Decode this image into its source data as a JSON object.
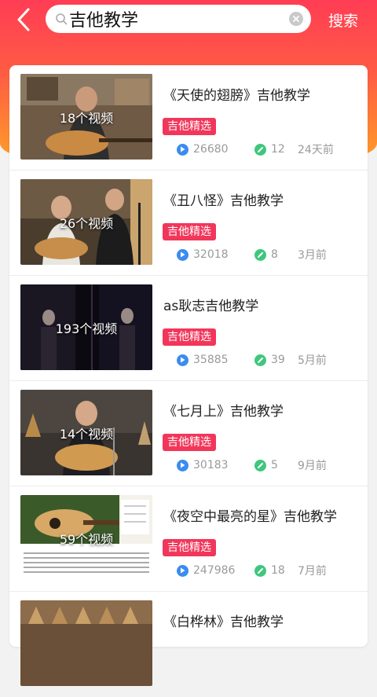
{
  "search": {
    "query": "吉他教学",
    "button_label": "搜索"
  },
  "colors": {
    "accent": "#f2365a",
    "header_top": "#ff3d55",
    "header_bottom": "#ff9a2a",
    "play": "#3b8cf0",
    "notes": "#3fc77d"
  },
  "items": [
    {
      "title": "《天使的翅膀》吉他教学",
      "count_label": "18个视频",
      "tag": "吉他精选",
      "views": "26680",
      "notes": "12",
      "age": "24天前"
    },
    {
      "title": "《丑八怪》吉他教学",
      "count_label": "26个视频",
      "tag": "吉他精选",
      "views": "32018",
      "notes": "8",
      "age": "3月前"
    },
    {
      "title": "as耿志吉他教学",
      "count_label": "193个视频",
      "tag": "吉他精选",
      "views": "35885",
      "notes": "39",
      "age": "5月前"
    },
    {
      "title": "《七月上》吉他教学",
      "count_label": "14个视频",
      "tag": "吉他精选",
      "views": "30183",
      "notes": "5",
      "age": "9月前"
    },
    {
      "title": "《夜空中最亮的星》吉他教学",
      "count_label": "59个视频",
      "tag": "吉他精选",
      "views": "247986",
      "notes": "18",
      "age": "7月前"
    },
    {
      "title": "《白桦林》吉他教学",
      "count_label": "",
      "tag": "",
      "views": "",
      "notes": "",
      "age": ""
    }
  ]
}
